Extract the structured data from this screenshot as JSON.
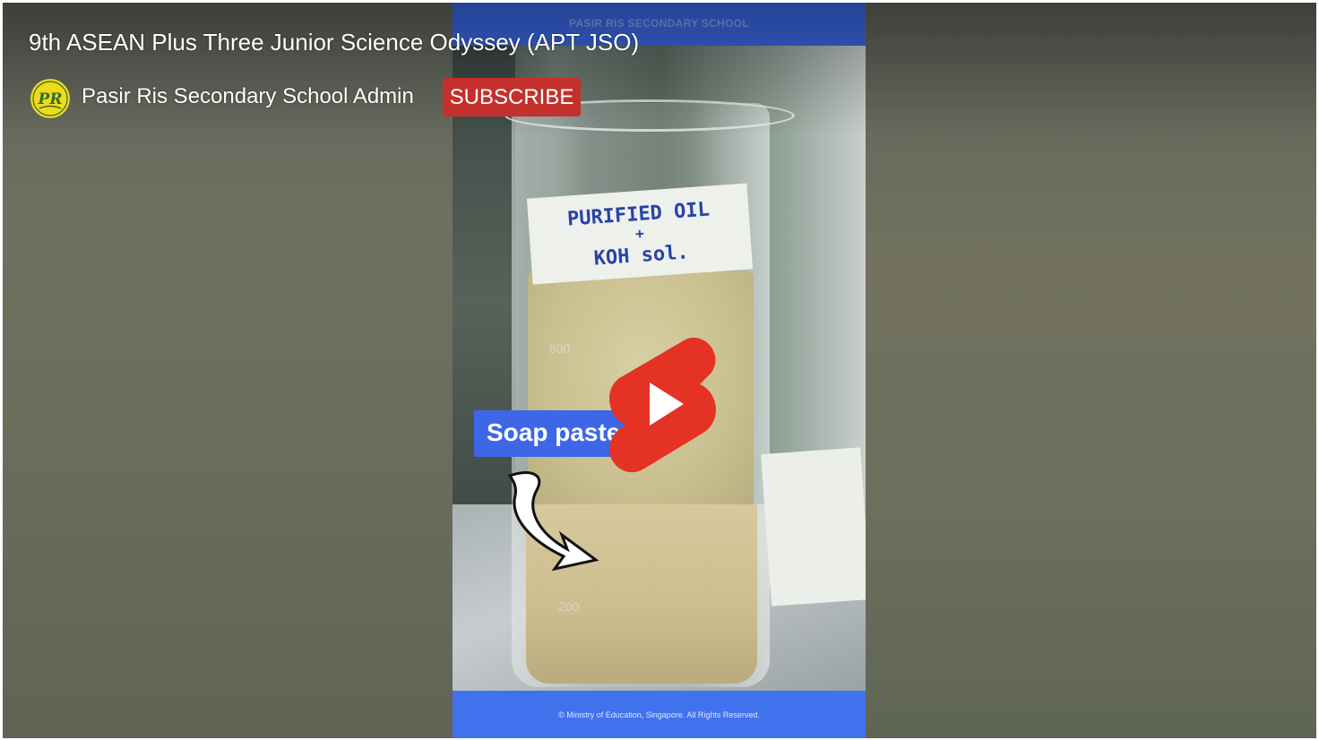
{
  "video": {
    "title": "9th ASEAN Plus Three Junior Science Odyssey (APT JSO)",
    "channel_name": "Pasir Ris Secondary School Admin",
    "subscribe_label": "SUBSCRIBE",
    "play_icon": "youtube-shorts-play-icon"
  },
  "frame": {
    "header_text": "PASIR RIS SECONDARY SCHOOL",
    "label_line1": "PURIFIED OIL",
    "label_line2": "+",
    "label_line3": "KOH sol.",
    "mark_upper": "800",
    "mark_lower": "200",
    "overlay_text": "Soap paste",
    "footer_text": "© Ministry of Education, Singapore. All Rights Reserved."
  },
  "colors": {
    "subscribe": "#c4302b",
    "shorts_red": "#e43225",
    "frame_blue": "#3d67e6",
    "avatar_yellow": "#f2d91b"
  }
}
